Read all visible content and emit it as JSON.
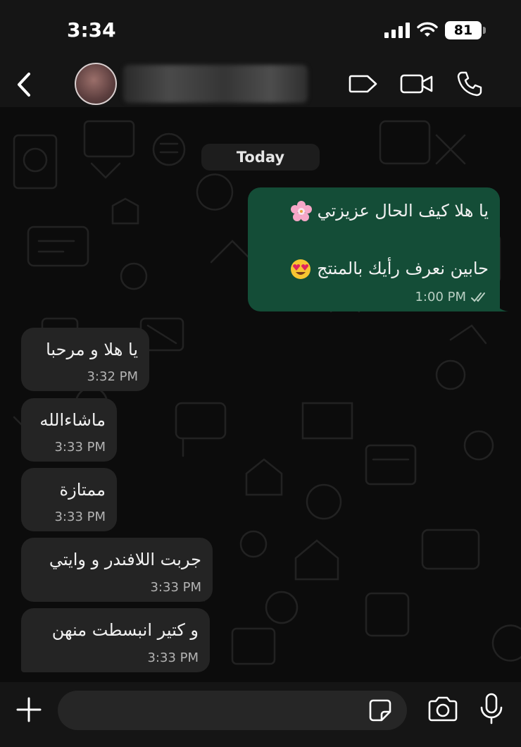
{
  "status_bar": {
    "time": "3:34",
    "battery": "81"
  },
  "header": {
    "contact_name": ""
  },
  "chat": {
    "date_separator": "Today",
    "messages": [
      {
        "direction": "outgoing",
        "lines": [
          "يا هلا كيف الحال عزيزتي",
          "",
          "حابين نعرف رأيك بالمنتج"
        ],
        "time": "1:00 PM",
        "status": "read"
      },
      {
        "direction": "incoming",
        "text": "يا هلا و مرحبا",
        "time": "3:32 PM"
      },
      {
        "direction": "incoming",
        "text": "ماشاءالله",
        "time": "3:33 PM"
      },
      {
        "direction": "incoming",
        "text": "ممتازة",
        "time": "3:33 PM"
      },
      {
        "direction": "incoming",
        "text": "جربت اللافندر و وايتي",
        "time": "3:33 PM"
      },
      {
        "direction": "incoming",
        "text": "و كتير انبسطت منهن",
        "time": "3:33 PM"
      }
    ]
  },
  "composer": {
    "value": ""
  },
  "colors": {
    "outgoing_bubble": "#144d37",
    "incoming_bubble": "#242424",
    "background": "#0c0c0c"
  },
  "icons": [
    "back-chevron",
    "video-call",
    "voice-call",
    "label",
    "plus",
    "sticker",
    "camera",
    "microphone",
    "double-check",
    "cherry-blossom-emoji",
    "heart-eyes-emoji"
  ]
}
